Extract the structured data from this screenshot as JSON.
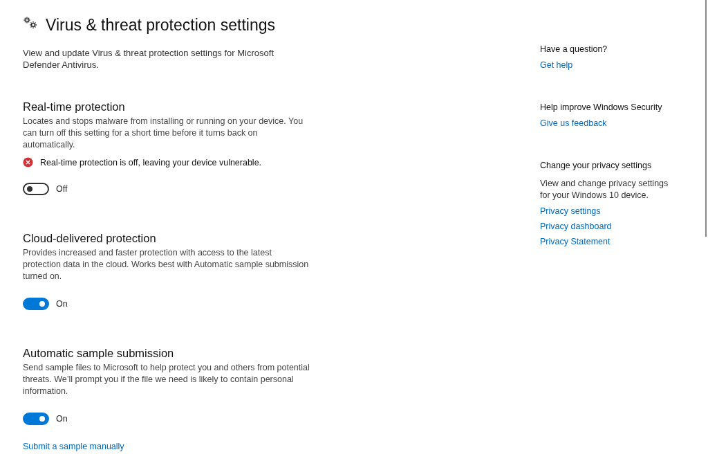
{
  "page": {
    "title": "Virus & threat protection settings",
    "subtitle": "View and update Virus & threat protection settings for Microsoft Defender Antivirus."
  },
  "sections": [
    {
      "title": "Real-time protection",
      "description": "Locates and stops malware from installing or running on your device. You can turn off this setting for a short time before it turns back on automatically.",
      "warning": "Real-time protection is off, leaving your device vulnerable.",
      "toggle": {
        "on": false,
        "label": "Off"
      }
    },
    {
      "title": "Cloud-delivered protection",
      "description": "Provides increased and faster protection with access to the latest protection data in the cloud. Works best with Automatic sample submission turned on.",
      "toggle": {
        "on": true,
        "label": "On"
      }
    },
    {
      "title": "Automatic sample submission",
      "description": "Send sample files to Microsoft to help protect you and others from potential threats. We’ll prompt you if the file we need is likely to contain personal information.",
      "toggle": {
        "on": true,
        "label": "On"
      },
      "link": "Submit a sample manually"
    }
  ],
  "sidebar": [
    {
      "heading": "Have a question?",
      "links": [
        "Get help"
      ]
    },
    {
      "heading": "Help improve Windows Security",
      "links": [
        "Give us feedback"
      ]
    },
    {
      "heading": "Change your privacy settings",
      "text": "View and change privacy settings for your Windows 10 device.",
      "links": [
        "Privacy settings",
        "Privacy dashboard",
        "Privacy Statement"
      ]
    }
  ]
}
